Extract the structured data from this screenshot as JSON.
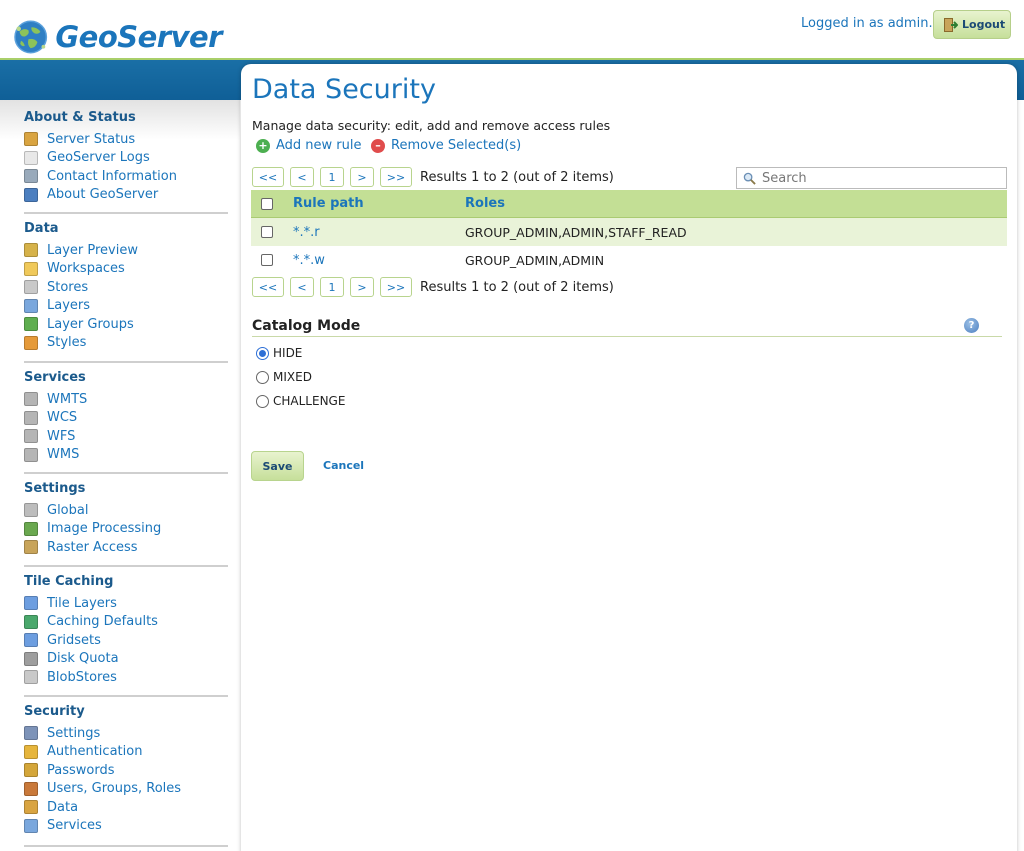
{
  "header": {
    "logo_text": "GeoServer",
    "logged_in": "Logged in as admin.",
    "logout_label": "Logout"
  },
  "sidebar": {
    "groups": [
      {
        "title": "About & Status",
        "items": [
          {
            "label": "Server Status",
            "icon": "server-status-icon"
          },
          {
            "label": "GeoServer Logs",
            "icon": "logs-icon"
          },
          {
            "label": "Contact Information",
            "icon": "contact-icon"
          },
          {
            "label": "About GeoServer",
            "icon": "about-icon"
          }
        ]
      },
      {
        "title": "Data",
        "items": [
          {
            "label": "Layer Preview",
            "icon": "layer-preview-icon"
          },
          {
            "label": "Workspaces",
            "icon": "folder-icon"
          },
          {
            "label": "Stores",
            "icon": "store-icon"
          },
          {
            "label": "Layers",
            "icon": "layers-icon"
          },
          {
            "label": "Layer Groups",
            "icon": "layer-groups-icon"
          },
          {
            "label": "Styles",
            "icon": "palette-icon"
          }
        ]
      },
      {
        "title": "Services",
        "items": [
          {
            "label": "WMTS",
            "icon": "service-icon"
          },
          {
            "label": "WCS",
            "icon": "service-icon"
          },
          {
            "label": "WFS",
            "icon": "service-icon"
          },
          {
            "label": "WMS",
            "icon": "service-icon"
          }
        ]
      },
      {
        "title": "Settings",
        "items": [
          {
            "label": "Global",
            "icon": "global-settings-icon"
          },
          {
            "label": "Image Processing",
            "icon": "image-processing-icon"
          },
          {
            "label": "Raster Access",
            "icon": "raster-access-icon"
          }
        ]
      },
      {
        "title": "Tile Caching",
        "items": [
          {
            "label": "Tile Layers",
            "icon": "grid-icon"
          },
          {
            "label": "Caching Defaults",
            "icon": "globe-icon"
          },
          {
            "label": "Gridsets",
            "icon": "grid-icon"
          },
          {
            "label": "Disk Quota",
            "icon": "disk-icon"
          },
          {
            "label": "BlobStores",
            "icon": "store-icon"
          }
        ]
      },
      {
        "title": "Security",
        "items": [
          {
            "label": "Settings",
            "icon": "wrench-icon"
          },
          {
            "label": "Authentication",
            "icon": "shield-icon"
          },
          {
            "label": "Passwords",
            "icon": "lock-icon"
          },
          {
            "label": "Users, Groups, Roles",
            "icon": "users-icon"
          },
          {
            "label": "Data",
            "icon": "data-security-icon"
          },
          {
            "label": "Services",
            "icon": "services-security-icon"
          }
        ]
      }
    ]
  },
  "main": {
    "title": "Data Security",
    "description": "Manage data security: edit, add and remove access rules",
    "add_rule": "Add new rule",
    "remove_selected": "Remove Selected(s)",
    "pager": {
      "first": "<<",
      "prev": "<",
      "page": "1",
      "next": ">",
      "last": ">>",
      "results": "Results 1 to 2 (out of 2 items)"
    },
    "search_placeholder": "Search",
    "table": {
      "headers": {
        "path": "Rule path",
        "roles": "Roles"
      },
      "rows": [
        {
          "path": "*.*.r",
          "roles": "GROUP_ADMIN,ADMIN,STAFF_READ"
        },
        {
          "path": "*.*.w",
          "roles": "GROUP_ADMIN,ADMIN"
        }
      ]
    },
    "catalog_mode": {
      "title": "Catalog Mode",
      "options": [
        "HIDE",
        "MIXED",
        "CHALLENGE"
      ],
      "selected": "HIDE"
    },
    "save_label": "Save",
    "cancel_label": "Cancel"
  },
  "colors": {
    "brand_blue": "#1b75bb",
    "header_band": "#1a6fa6",
    "table_header_green": "#c3df95",
    "row_alt_green": "#e9f3d8"
  }
}
